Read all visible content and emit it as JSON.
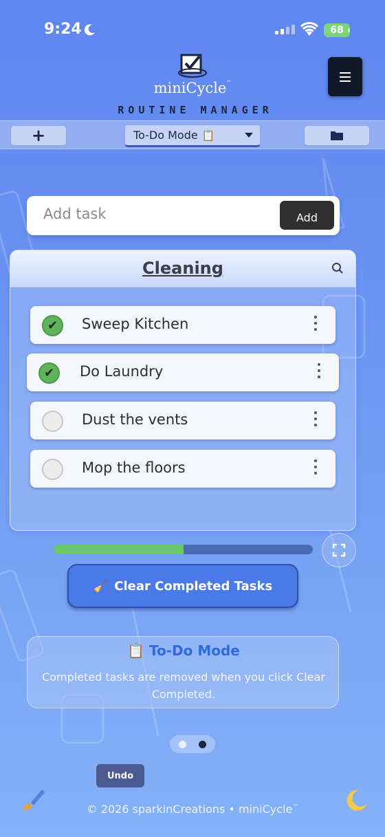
{
  "status": {
    "time": "9:24",
    "battery": "68"
  },
  "header": {
    "app_name": "miniCycle",
    "trademark": "™",
    "subtitle": "ROUTINE MANAGER"
  },
  "toolbar": {
    "add_label": "+",
    "mode_label": "To-Do Mode",
    "mode_icon": "📋"
  },
  "add_task": {
    "placeholder": "Add task",
    "button_label": "Add"
  },
  "list": {
    "title": "Cleaning",
    "tasks": [
      {
        "label": "Sweep Kitchen",
        "completed": true
      },
      {
        "label": "Do Laundry",
        "completed": true
      },
      {
        "label": "Dust the vents",
        "completed": false
      },
      {
        "label": "Mop the floors",
        "completed": false
      }
    ]
  },
  "progress": {
    "value": 0.5
  },
  "clear_button": {
    "icon": "🧹",
    "label": "Clear Completed Tasks"
  },
  "mode_info": {
    "icon": "📋",
    "title": "To-Do Mode",
    "description": "Completed tasks are removed when you click Clear Completed."
  },
  "pager": {
    "pages": 2,
    "active": 1
  },
  "undo": {
    "label": "Undo"
  },
  "footer": {
    "text": "© 2026 sparkinCreations • miniCycle",
    "trademark": "™"
  },
  "colors": {
    "accent": "#4a7ae8",
    "progress_done": "#6cc66c",
    "progress_remaining": "#4b6cb5",
    "check_done": "#5fb35a",
    "mode_title": "#2f6be0"
  }
}
